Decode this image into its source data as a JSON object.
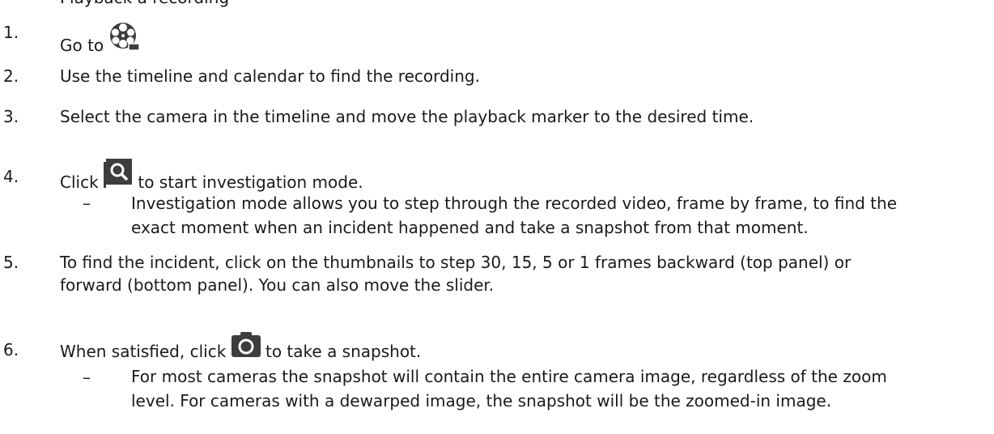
{
  "intro": {
    "partial_text": "Playback a recording"
  },
  "steps": [
    {
      "number": "1.",
      "before": "Go to ",
      "icon": "film-reel-icon",
      "after": ""
    },
    {
      "number": "2.",
      "text": "Use the timeline and calendar to find the recording."
    },
    {
      "number": "3.",
      "text": "Select the camera in the timeline and move the playback marker to the desired time."
    },
    {
      "number": "4.",
      "before": "Click ",
      "icon": "investigation-search-icon",
      "after": " to start investigation mode."
    },
    {
      "number": "5.",
      "line1": "To find the incident, click on the thumbnails to step 30, 15, 5 or 1 frames backward (top panel) or",
      "line2": "forward (bottom panel). You can also move the slider."
    },
    {
      "number": "6.",
      "before": "When satisfied, click ",
      "icon": "camera-icon",
      "after": " to take a snapshot."
    }
  ],
  "notes": {
    "step4": {
      "dash": "–",
      "line1": "Investigation mode allows you to step through the recorded video, frame by frame, to find the",
      "line2": "exact moment when an incident happened and take a snapshot from that moment."
    },
    "step6": {
      "dash": "–",
      "line1": "For most cameras the snapshot will contain the entire camera image, regardless of the zoom",
      "line2": "level. For cameras with a dewarped image, the snapshot will be the zoomed-in image."
    }
  },
  "colors": {
    "text": "#1a1a1a",
    "icon": "#3d3d3d"
  }
}
